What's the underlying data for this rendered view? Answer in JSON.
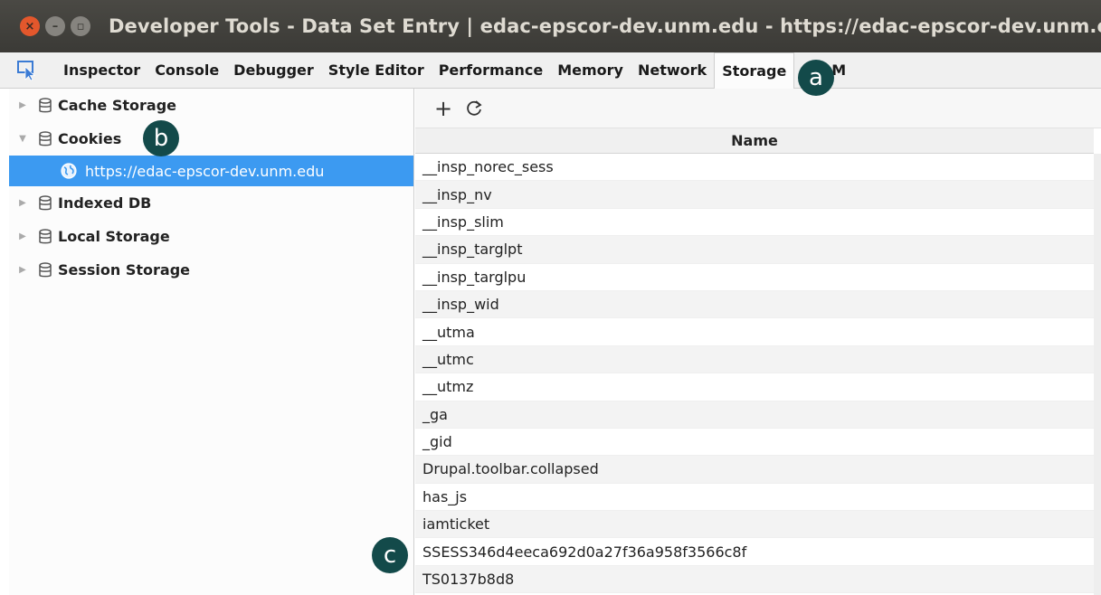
{
  "window": {
    "title": "Developer Tools - Data Set Entry | edac-epscor-dev.unm.edu - https://edac-epscor-dev.unm.edu"
  },
  "tabs": [
    {
      "label": "Inspector"
    },
    {
      "label": "Console"
    },
    {
      "label": "Debugger"
    },
    {
      "label": "Style Editor"
    },
    {
      "label": "Performance"
    },
    {
      "label": "Memory"
    },
    {
      "label": "Network"
    },
    {
      "label": "Storage",
      "active": true
    },
    {
      "label": "DOM"
    }
  ],
  "sidebar": {
    "items": [
      {
        "label": "Cache Storage",
        "expanded": false
      },
      {
        "label": "Cookies",
        "expanded": true
      },
      {
        "label": "Indexed DB",
        "expanded": false
      },
      {
        "label": "Local Storage",
        "expanded": false
      },
      {
        "label": "Session Storage",
        "expanded": false
      }
    ],
    "cookie_host": "https://edac-epscor-dev.unm.edu"
  },
  "toolbar": {
    "add_icon": "plus-icon",
    "refresh_icon": "refresh-icon"
  },
  "table": {
    "column_header": "Name",
    "rows": [
      "__insp_norec_sess",
      "__insp_nv",
      "__insp_slim",
      "__insp_targlpt",
      "__insp_targlpu",
      "__insp_wid",
      "__utma",
      "__utmc",
      "__utmz",
      "_ga",
      "_gid",
      "Drupal.toolbar.collapsed",
      "has_js",
      "iamticket",
      "SSESS346d4eeca692d0a27f36a958f3566c8f",
      "TS0137b8d8"
    ]
  },
  "callouts": {
    "a": "a",
    "b": "b",
    "c": "c"
  },
  "colors": {
    "selected_row": "#3c9af1",
    "callout": "#134a4a",
    "close_button": "#e3572c"
  }
}
